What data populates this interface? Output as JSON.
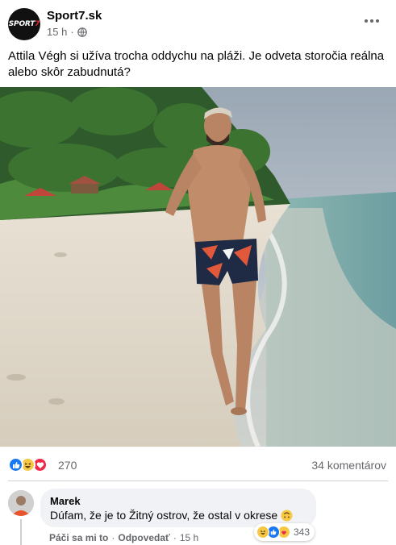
{
  "post": {
    "page_name": "Sport7.sk",
    "time": "15 h",
    "visibility_dot": "·",
    "text": "Attila Végh si užíva trocha oddychu na pláži. Je odveta storočia reálna alebo skôr zabudnutá?",
    "avatar_logo_text": "SPORT",
    "avatar_logo_accent": "7"
  },
  "reactions": {
    "icons": [
      "like-icon",
      "haha-icon",
      "love-icon"
    ],
    "count": "270",
    "comments": "34 komentárov"
  },
  "comment": {
    "author": "Marek",
    "text": "Dúfam, že je to Žitný ostrov, že ostal v okrese",
    "emoji": "upside-down-face-icon",
    "actions": {
      "like": "Páči sa mi to",
      "separator": "·",
      "reply": "Odpovedať",
      "time": "15 h"
    },
    "reaction_icons": [
      "haha-icon",
      "like-icon",
      "care-icon"
    ],
    "reaction_count": "343"
  },
  "colors": {
    "accent": "#1877f2",
    "secondary_text": "#65676b",
    "bubble": "#f0f2f5",
    "love": "#f0284a",
    "haha": "#f7c844"
  }
}
